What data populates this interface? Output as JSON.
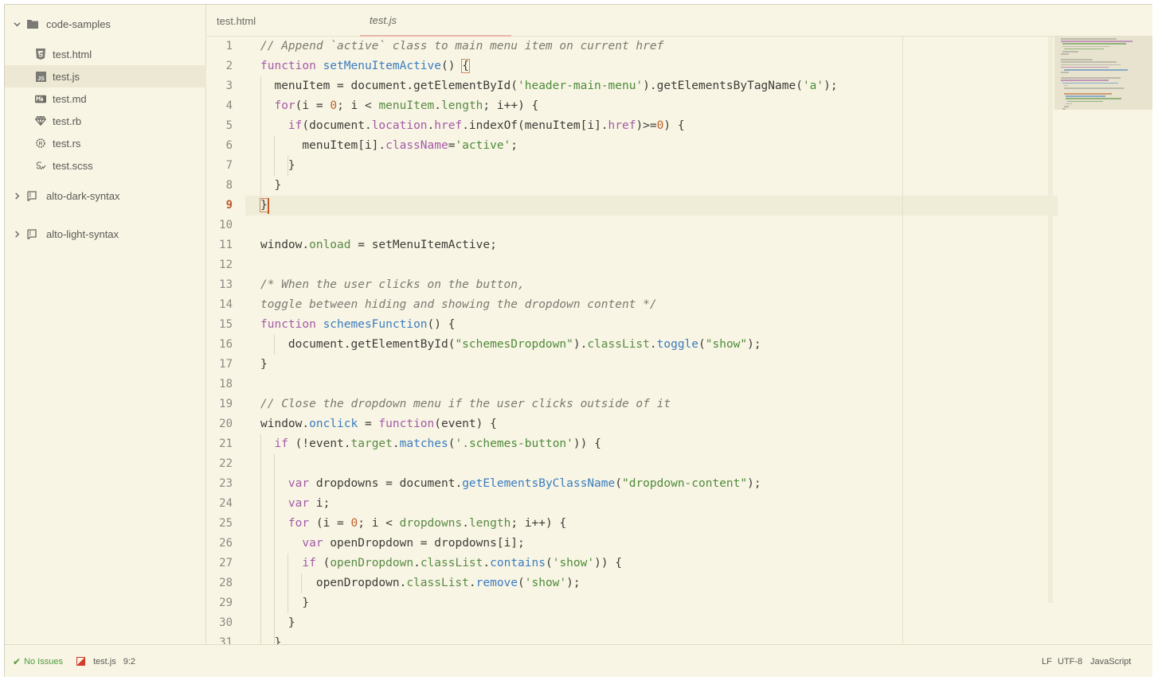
{
  "sidebar": {
    "project": "code-samples",
    "files": [
      {
        "name": "test.html",
        "icon": "html5-icon"
      },
      {
        "name": "test.js",
        "icon": "js-icon"
      },
      {
        "name": "test.md",
        "icon": "markdown-icon"
      },
      {
        "name": "test.rb",
        "icon": "ruby-icon"
      },
      {
        "name": "test.rs",
        "icon": "rust-icon"
      },
      {
        "name": "test.scss",
        "icon": "sass-icon"
      }
    ],
    "folders": [
      "alto-dark-syntax",
      "alto-light-syntax"
    ]
  },
  "tabs": [
    {
      "label": "test.html"
    },
    {
      "label": "test.js"
    }
  ],
  "editor": {
    "current_line": "9",
    "line_numbers": [
      "1",
      "2",
      "3",
      "4",
      "5",
      "6",
      "7",
      "8",
      "9",
      "10",
      "11",
      "12",
      "13",
      "14",
      "15",
      "16",
      "17",
      "18",
      "19",
      "20",
      "21",
      "22",
      "23",
      "24",
      "25",
      "26",
      "27",
      "28",
      "29",
      "30",
      "31"
    ]
  },
  "status": {
    "issues": "No Issues",
    "file": "test.js",
    "cursor": "9:2",
    "line_ending": "LF",
    "encoding": "UTF-8",
    "grammar": "JavaScript"
  },
  "colors": {
    "background": "#f8f5e4",
    "keyword": "#a35aa8",
    "function": "#3a7cc0",
    "string": "#4e8a3a",
    "number": "#c0602a",
    "comment": "#7a7a70",
    "accent": "#b85a2e"
  }
}
